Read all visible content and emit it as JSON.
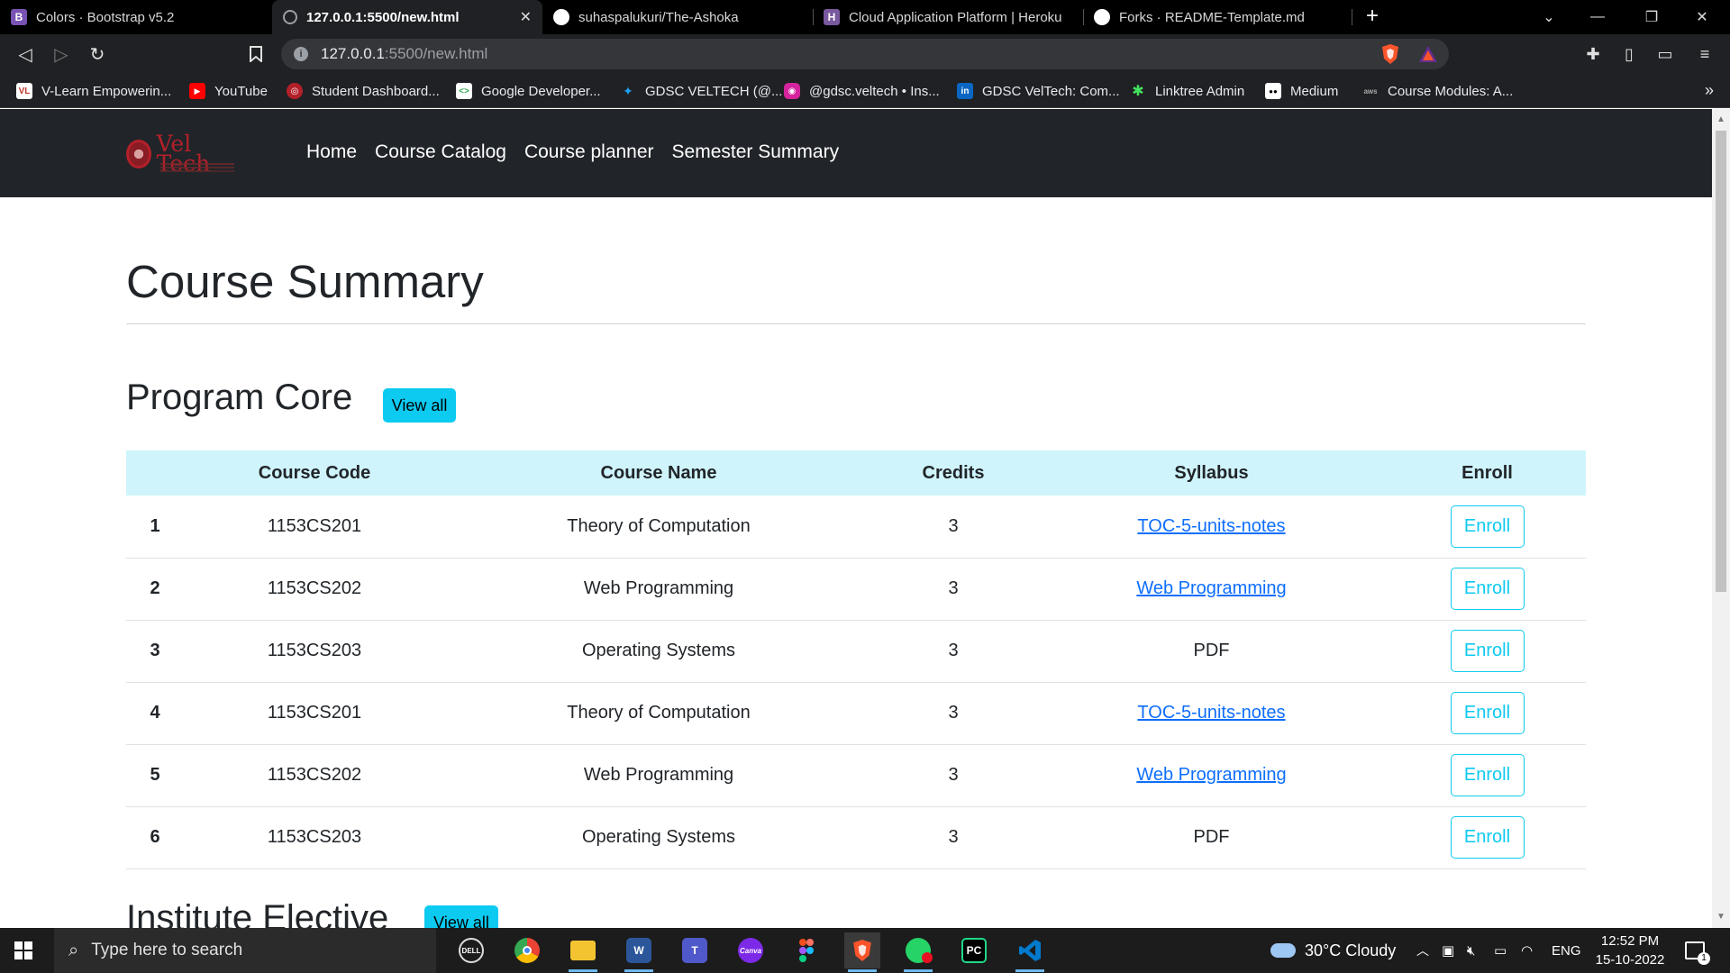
{
  "browser": {
    "tabs": [
      {
        "title": "Colors · Bootstrap v5.2",
        "icon": "bootstrap-icon",
        "badge": "B",
        "color": "#7952b3"
      },
      {
        "title": "127.0.0.1:5500/new.html",
        "icon": "globe-icon",
        "badge": "",
        "color": "#5f6368"
      },
      {
        "title": "suhaspalukuri/The-Ashoka",
        "icon": "github-icon",
        "badge": "",
        "color": "#ffffff"
      },
      {
        "title": "Cloud Application Platform | Heroku",
        "icon": "heroku-icon",
        "badge": "H",
        "color": "#79589f"
      },
      {
        "title": "Forks · README-Template.md",
        "icon": "github-icon",
        "badge": "",
        "color": "#ffffff"
      }
    ],
    "active_tab_index": 1,
    "url_host": "127.0.0.1",
    "url_path": ":5500/new.html",
    "bookmarks": [
      {
        "label": "V-Learn Empowerin...",
        "icon": "vlearn-icon",
        "badge": "VL",
        "color": "#c0392b"
      },
      {
        "label": "YouTube",
        "icon": "youtube-icon",
        "badge": "▶",
        "color": "#ff0000"
      },
      {
        "label": "Student Dashboard...",
        "icon": "student-dashboard-icon",
        "badge": "◎",
        "color": "#b3202a"
      },
      {
        "label": "Google Developer...",
        "icon": "google-developers-icon",
        "badge": "<>",
        "color": "#ffffff"
      },
      {
        "label": "GDSC VELTECH (@...",
        "icon": "twitter-icon",
        "badge": "✦",
        "color": "#1da1f2"
      },
      {
        "label": "@gdsc.veltech • Ins...",
        "icon": "instagram-icon",
        "badge": "◉",
        "color": "#d6249f"
      },
      {
        "label": "GDSC VelTech: Com...",
        "icon": "linkedin-icon",
        "badge": "in",
        "color": "#0a66c2"
      },
      {
        "label": "Linktree Admin",
        "icon": "linktree-icon",
        "badge": "✱",
        "color": "#43e55e"
      },
      {
        "label": "Medium",
        "icon": "medium-icon",
        "badge": "●●",
        "color": "#000000"
      },
      {
        "label": "Course Modules: A...",
        "icon": "aws-icon",
        "badge": "aws",
        "color": "#232f3e"
      }
    ]
  },
  "site": {
    "logo_text": "Vel Tech",
    "nav": [
      "Home",
      "Course Catalog",
      "Course planner",
      "Semester Summary"
    ],
    "page_title": "Course Summary",
    "sections": [
      {
        "title": "Program Core",
        "view_all": "View all"
      },
      {
        "title": "Institute Elective",
        "view_all": "View all"
      }
    ],
    "table": {
      "headers": [
        "",
        "Course Code",
        "Course Name",
        "Credits",
        "Syllabus",
        "Enroll"
      ],
      "rows": [
        {
          "n": "1",
          "code": "1153CS201",
          "name": "Theory of Computation",
          "credits": "3",
          "syllabus": "TOC-5-units-notes",
          "link": true,
          "enroll": "Enroll"
        },
        {
          "n": "2",
          "code": "1153CS202",
          "name": "Web Programming",
          "credits": "3",
          "syllabus": "Web Programming",
          "link": true,
          "enroll": "Enroll"
        },
        {
          "n": "3",
          "code": "1153CS203",
          "name": "Operating Systems",
          "credits": "3",
          "syllabus": "PDF",
          "link": false,
          "enroll": "Enroll"
        },
        {
          "n": "4",
          "code": "1153CS201",
          "name": "Theory of Computation",
          "credits": "3",
          "syllabus": "TOC-5-units-notes",
          "link": true,
          "enroll": "Enroll"
        },
        {
          "n": "5",
          "code": "1153CS202",
          "name": "Web Programming",
          "credits": "3",
          "syllabus": "Web Programming",
          "link": true,
          "enroll": "Enroll"
        },
        {
          "n": "6",
          "code": "1153CS203",
          "name": "Operating Systems",
          "credits": "3",
          "syllabus": "PDF",
          "link": false,
          "enroll": "Enroll"
        }
      ]
    },
    "colors": {
      "navbar": "#212529",
      "accent": "#0dcaf0",
      "header_row": "#cff4fc",
      "link": "#0d6efd"
    }
  },
  "taskbar": {
    "search_placeholder": "Type here to search",
    "apps": [
      {
        "name": "dell-icon",
        "label": "DELL",
        "color": "#2b2b2b"
      },
      {
        "name": "chrome-icon",
        "label": "",
        "color": "#4285f4"
      },
      {
        "name": "file-explorer-icon",
        "label": "",
        "color": "#f4c430"
      },
      {
        "name": "word-icon",
        "label": "W",
        "color": "#2b579a"
      },
      {
        "name": "teams-icon",
        "label": "T",
        "color": "#5059c9"
      },
      {
        "name": "canva-icon",
        "label": "Canva",
        "color": "#00c4cc"
      },
      {
        "name": "figma-icon",
        "label": "",
        "color": "#f24e1e"
      },
      {
        "name": "brave-icon",
        "label": "",
        "color": "#fb542b"
      },
      {
        "name": "whatsapp-icon",
        "label": "",
        "color": "#25d366"
      },
      {
        "name": "pycharm-icon",
        "label": "PC",
        "color": "#000000"
      },
      {
        "name": "vscode-icon",
        "label": "",
        "color": "#007acc"
      }
    ],
    "weather": "30°C  Cloudy",
    "language": "ENG",
    "time": "12:52 PM",
    "date": "15-10-2022",
    "notification_count": "1"
  }
}
